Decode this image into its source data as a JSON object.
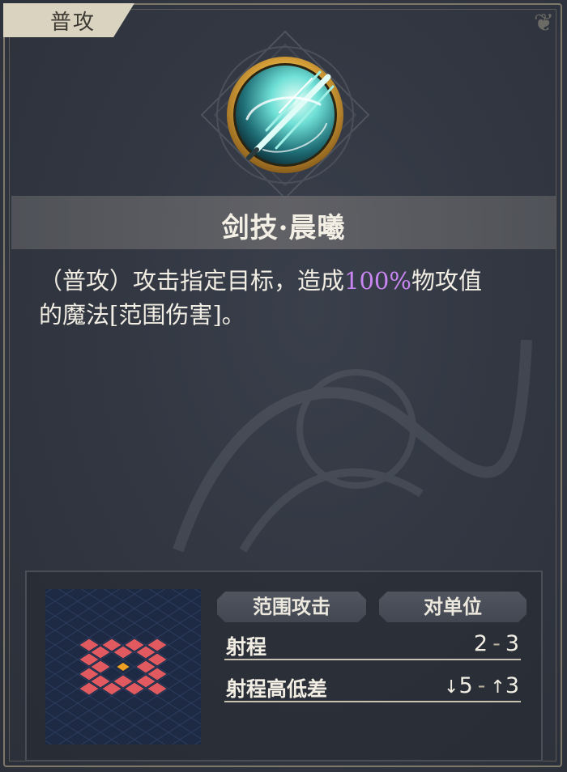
{
  "tag": {
    "label": "普攻"
  },
  "skill": {
    "name": "剑技·晨曦",
    "icon": "sword-light-icon",
    "description": {
      "line1_before": "（普攻）攻击指定目标，造成",
      "highlight": "100%",
      "line1_after": "物攻值",
      "line2": "的魔法[范围伤害]。"
    }
  },
  "pills": {
    "attack_type": "范围攻击",
    "target_type": "对单位"
  },
  "stats": {
    "range": {
      "label": "射程",
      "min": "2",
      "sep": "-",
      "max": "3"
    },
    "height": {
      "label": "射程高低差",
      "down_arrow": "↓",
      "down": "5",
      "sep": "-",
      "up_arrow": "↑",
      "up": "3"
    }
  },
  "colors": {
    "background": "#2b3039",
    "highlight": "#c985f2",
    "tile_red": "#e05a60",
    "tile_center": "#f0a020",
    "tag_bg": "#d9d3bf"
  }
}
